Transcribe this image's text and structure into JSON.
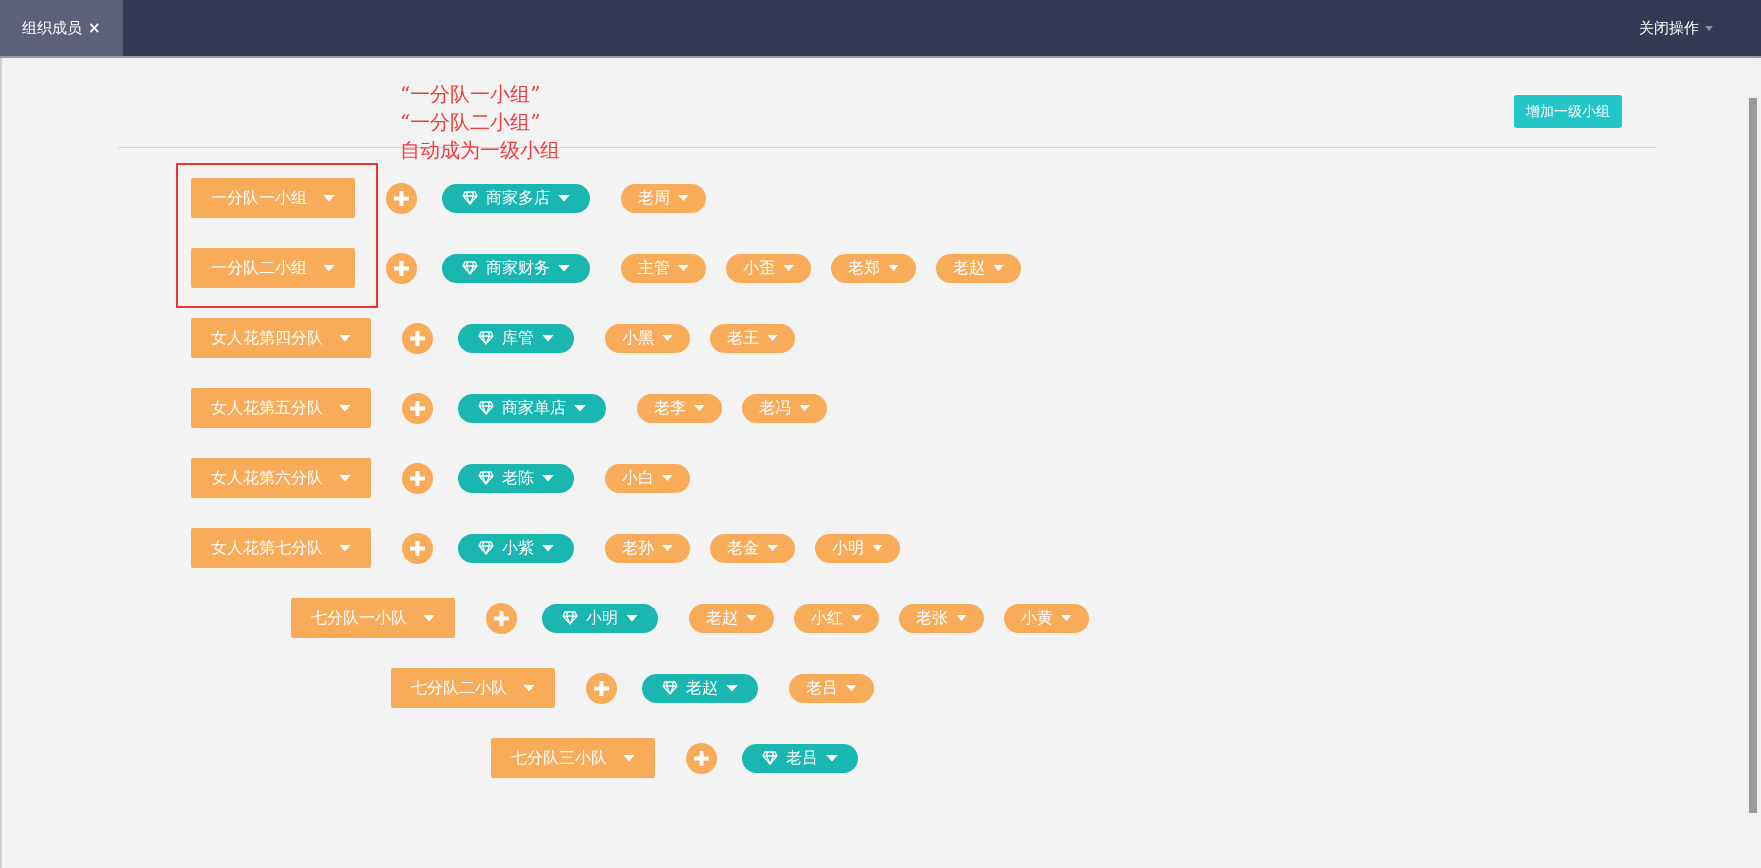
{
  "tabs": [
    {
      "label": "组织成员",
      "close": "×",
      "selected": true
    }
  ],
  "close_menu": "关闭操作",
  "add_top_group": "增加一级小组",
  "annotation": {
    "lines": [
      "“一分队一小组”",
      "“一分队二小组”",
      "自动成为一级小组"
    ]
  },
  "groups": [
    {
      "name": "一分队一小组",
      "leader": "商家多店",
      "members": [
        "老周"
      ],
      "highlighted": true
    },
    {
      "name": "一分队二小组",
      "leader": "商家财务",
      "members": [
        "主管",
        "小歪",
        "老郑",
        "老赵"
      ],
      "highlighted": true
    },
    {
      "name": "女人花第四分队",
      "leader": "库管",
      "members": [
        "小黑",
        "老王"
      ],
      "highlighted": false
    },
    {
      "name": "女人花第五分队",
      "leader": "商家单店",
      "members": [
        "老李",
        "老冯"
      ],
      "highlighted": false
    },
    {
      "name": "女人花第六分队",
      "leader": "老陈",
      "members": [
        "小白"
      ],
      "highlighted": false
    },
    {
      "name": "女人花第七分队",
      "leader": "小紫",
      "members": [
        "老孙",
        "老金",
        "小明"
      ],
      "highlighted": false,
      "children": [
        {
          "name": "七分队一小队",
          "leader": "小明",
          "members": [
            "老赵",
            "小红",
            "老张",
            "小黄"
          ],
          "highlighted": false,
          "children": [
            {
              "name": "七分队二小队",
              "leader": "老赵",
              "members": [
                "老吕"
              ],
              "highlighted": false,
              "children": [
                {
                  "name": "七分队三小队",
                  "leader": "老吕",
                  "highlighted": false
                }
              ]
            }
          ]
        }
      ]
    }
  ]
}
